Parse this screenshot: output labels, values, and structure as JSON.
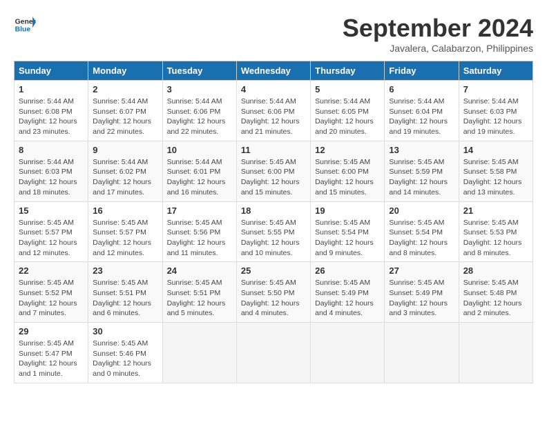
{
  "header": {
    "logo_line1": "General",
    "logo_line2": "Blue",
    "month_title": "September 2024",
    "location": "Javalera, Calabarzon, Philippines"
  },
  "weekdays": [
    "Sunday",
    "Monday",
    "Tuesday",
    "Wednesday",
    "Thursday",
    "Friday",
    "Saturday"
  ],
  "weeks": [
    [
      {
        "day": "1",
        "sunrise": "5:44 AM",
        "sunset": "6:08 PM",
        "daylight": "12 hours and 23 minutes."
      },
      {
        "day": "2",
        "sunrise": "5:44 AM",
        "sunset": "6:07 PM",
        "daylight": "12 hours and 22 minutes."
      },
      {
        "day": "3",
        "sunrise": "5:44 AM",
        "sunset": "6:06 PM",
        "daylight": "12 hours and 22 minutes."
      },
      {
        "day": "4",
        "sunrise": "5:44 AM",
        "sunset": "6:06 PM",
        "daylight": "12 hours and 21 minutes."
      },
      {
        "day": "5",
        "sunrise": "5:44 AM",
        "sunset": "6:05 PM",
        "daylight": "12 hours and 20 minutes."
      },
      {
        "day": "6",
        "sunrise": "5:44 AM",
        "sunset": "6:04 PM",
        "daylight": "12 hours and 19 minutes."
      },
      {
        "day": "7",
        "sunrise": "5:44 AM",
        "sunset": "6:03 PM",
        "daylight": "12 hours and 19 minutes."
      }
    ],
    [
      {
        "day": "8",
        "sunrise": "5:44 AM",
        "sunset": "6:03 PM",
        "daylight": "12 hours and 18 minutes."
      },
      {
        "day": "9",
        "sunrise": "5:44 AM",
        "sunset": "6:02 PM",
        "daylight": "12 hours and 17 minutes."
      },
      {
        "day": "10",
        "sunrise": "5:44 AM",
        "sunset": "6:01 PM",
        "daylight": "12 hours and 16 minutes."
      },
      {
        "day": "11",
        "sunrise": "5:45 AM",
        "sunset": "6:00 PM",
        "daylight": "12 hours and 15 minutes."
      },
      {
        "day": "12",
        "sunrise": "5:45 AM",
        "sunset": "6:00 PM",
        "daylight": "12 hours and 15 minutes."
      },
      {
        "day": "13",
        "sunrise": "5:45 AM",
        "sunset": "5:59 PM",
        "daylight": "12 hours and 14 minutes."
      },
      {
        "day": "14",
        "sunrise": "5:45 AM",
        "sunset": "5:58 PM",
        "daylight": "12 hours and 13 minutes."
      }
    ],
    [
      {
        "day": "15",
        "sunrise": "5:45 AM",
        "sunset": "5:57 PM",
        "daylight": "12 hours and 12 minutes."
      },
      {
        "day": "16",
        "sunrise": "5:45 AM",
        "sunset": "5:57 PM",
        "daylight": "12 hours and 12 minutes."
      },
      {
        "day": "17",
        "sunrise": "5:45 AM",
        "sunset": "5:56 PM",
        "daylight": "12 hours and 11 minutes."
      },
      {
        "day": "18",
        "sunrise": "5:45 AM",
        "sunset": "5:55 PM",
        "daylight": "12 hours and 10 minutes."
      },
      {
        "day": "19",
        "sunrise": "5:45 AM",
        "sunset": "5:54 PM",
        "daylight": "12 hours and 9 minutes."
      },
      {
        "day": "20",
        "sunrise": "5:45 AM",
        "sunset": "5:54 PM",
        "daylight": "12 hours and 8 minutes."
      },
      {
        "day": "21",
        "sunrise": "5:45 AM",
        "sunset": "5:53 PM",
        "daylight": "12 hours and 8 minutes."
      }
    ],
    [
      {
        "day": "22",
        "sunrise": "5:45 AM",
        "sunset": "5:52 PM",
        "daylight": "12 hours and 7 minutes."
      },
      {
        "day": "23",
        "sunrise": "5:45 AM",
        "sunset": "5:51 PM",
        "daylight": "12 hours and 6 minutes."
      },
      {
        "day": "24",
        "sunrise": "5:45 AM",
        "sunset": "5:51 PM",
        "daylight": "12 hours and 5 minutes."
      },
      {
        "day": "25",
        "sunrise": "5:45 AM",
        "sunset": "5:50 PM",
        "daylight": "12 hours and 4 minutes."
      },
      {
        "day": "26",
        "sunrise": "5:45 AM",
        "sunset": "5:49 PM",
        "daylight": "12 hours and 4 minutes."
      },
      {
        "day": "27",
        "sunrise": "5:45 AM",
        "sunset": "5:49 PM",
        "daylight": "12 hours and 3 minutes."
      },
      {
        "day": "28",
        "sunrise": "5:45 AM",
        "sunset": "5:48 PM",
        "daylight": "12 hours and 2 minutes."
      }
    ],
    [
      {
        "day": "29",
        "sunrise": "5:45 AM",
        "sunset": "5:47 PM",
        "daylight": "12 hours and 1 minute."
      },
      {
        "day": "30",
        "sunrise": "5:45 AM",
        "sunset": "5:46 PM",
        "daylight": "12 hours and 0 minutes."
      },
      null,
      null,
      null,
      null,
      null
    ]
  ]
}
